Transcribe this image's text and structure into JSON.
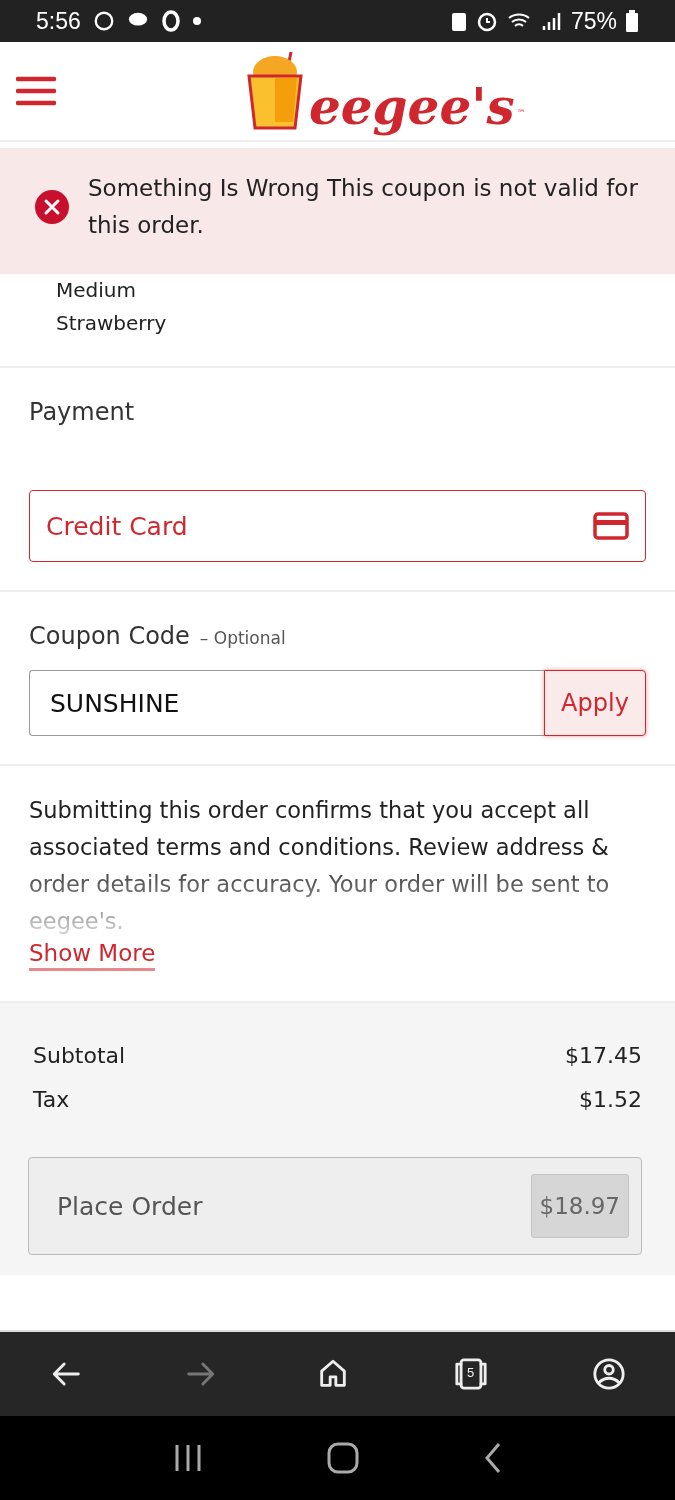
{
  "status_bar": {
    "time": "5:56",
    "battery": "75%"
  },
  "header": {
    "logo": {
      "name": "eegee's",
      "mark": "™"
    }
  },
  "alert": {
    "kind": "error",
    "message": "Something Is Wrong This coupon is not valid for this order."
  },
  "order_item": {
    "lines": [
      "Medium",
      "Strawberry"
    ]
  },
  "payment": {
    "title": "Payment",
    "method": "Credit Card"
  },
  "coupon": {
    "title": "Coupon Code",
    "hint": "– Optional",
    "value": "SUNSHINE",
    "button": "Apply"
  },
  "terms": {
    "text": "Submitting this order confirms that you accept all associated terms and conditions. Review address & order details for accuracy. Your order will be sent to eegee's.",
    "link": "Show More"
  },
  "summary": {
    "rows": [
      {
        "label": "Subtotal",
        "value": "$17.45"
      },
      {
        "label": "Tax",
        "value": "$1.52"
      }
    ],
    "place_order": {
      "label": "Place Order",
      "total": "$18.97"
    }
  },
  "browser_bar": [
    {
      "kind": "back",
      "disabled": false
    },
    {
      "kind": "forward",
      "disabled": true
    },
    {
      "kind": "home",
      "disabled": false
    },
    {
      "kind": "tabs",
      "count": "5",
      "disabled": false
    },
    {
      "kind": "account",
      "disabled": false
    }
  ]
}
